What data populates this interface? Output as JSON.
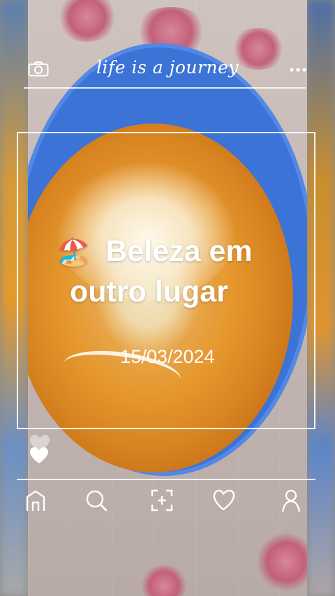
{
  "header": {
    "brand_text": "life is a journey",
    "left_icon": "camera-icon",
    "right_icon": "more-dots-icon"
  },
  "post": {
    "emoji": "🏖️",
    "title": "Beleza em outro lugar",
    "date": "15/03/2024"
  },
  "reactions": {
    "icons": [
      "heart-faded-icon",
      "heart-icon"
    ]
  },
  "bottom_nav": {
    "items": [
      {
        "icon": "home-icon"
      },
      {
        "icon": "search-icon"
      },
      {
        "icon": "add-post-icon"
      },
      {
        "icon": "heart-outline-icon"
      },
      {
        "icon": "profile-icon"
      }
    ]
  },
  "colors": {
    "overlay_text": "#ffffff",
    "bowl_blue": "#3b73d6",
    "sauce_orange": "#e6982e"
  }
}
